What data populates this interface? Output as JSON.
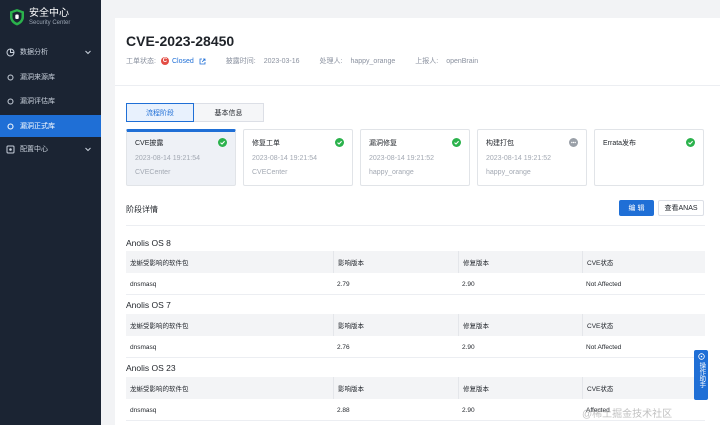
{
  "brand": {
    "name_cn": "安全中心",
    "name_en": "Security Center"
  },
  "sidebar": {
    "items": [
      {
        "label": "数据分析",
        "icon": "analytics-icon",
        "expandable": true
      },
      {
        "label": "漏洞来源库",
        "icon": "dot-icon",
        "expandable": false
      },
      {
        "label": "漏洞评估库",
        "icon": "dot-icon",
        "expandable": false
      },
      {
        "label": "漏洞正式库",
        "icon": "dot-icon",
        "expandable": false,
        "active": true
      },
      {
        "label": "配置中心",
        "icon": "settings-icon",
        "expandable": true
      }
    ]
  },
  "page": {
    "title": "CVE-2023-28450",
    "status_label": "工单状态:",
    "status_value": "Closed",
    "disclosure_label": "披露时间:",
    "disclosure_value": "2023-03-16",
    "handler_label": "处理人:",
    "handler_value": "happy_orange",
    "reporter_label": "上报人:",
    "reporter_value": "openBrain"
  },
  "tabs": [
    {
      "label": "流程阶段",
      "active": true
    },
    {
      "label": "基本信息",
      "active": false
    }
  ],
  "steps": [
    {
      "name": "CVE披露",
      "time": "2023-08-14 19:21:54",
      "user": "CVECenter",
      "state": "done",
      "active": true
    },
    {
      "name": "修复工单",
      "time": "2023-08-14 19:21:54",
      "user": "CVECenter",
      "state": "done",
      "active": false
    },
    {
      "name": "漏洞修复",
      "time": "2023-08-14 19:21:52",
      "user": "happy_orange",
      "state": "done",
      "active": false
    },
    {
      "name": "构建打包",
      "time": "2023-08-14 19:21:52",
      "user": "happy_orange",
      "state": "pending",
      "active": false
    },
    {
      "name": "Errata发布",
      "time": "",
      "user": "",
      "state": "done",
      "active": false
    }
  ],
  "details": {
    "title": "阶段详情",
    "primary_button": "编 辑",
    "secondary_button": "查看ANAS"
  },
  "table_headers": [
    "龙蜥受影响的软件包",
    "影响版本",
    "修复版本",
    "CVE状态"
  ],
  "os_sections": [
    {
      "name": "Anolis OS 8",
      "rows": [
        [
          "dnsmasq",
          "2.79",
          "2.90",
          "Not Affected"
        ]
      ]
    },
    {
      "name": "Anolis OS 7",
      "rows": [
        [
          "dnsmasq",
          "2.76",
          "2.90",
          "Not Affected"
        ]
      ]
    },
    {
      "name": "Anolis OS 23",
      "rows": [
        [
          "dnsmasq",
          "2.88",
          "2.90",
          "Affected"
        ]
      ]
    }
  ],
  "assistant": {
    "label": "操作助手"
  },
  "watermark": "@稀土掘金技术社区",
  "colors": {
    "accent": "#1f6fd6",
    "sidebar": "#1b2433",
    "success": "#2bb24c",
    "danger": "#e34d45"
  }
}
